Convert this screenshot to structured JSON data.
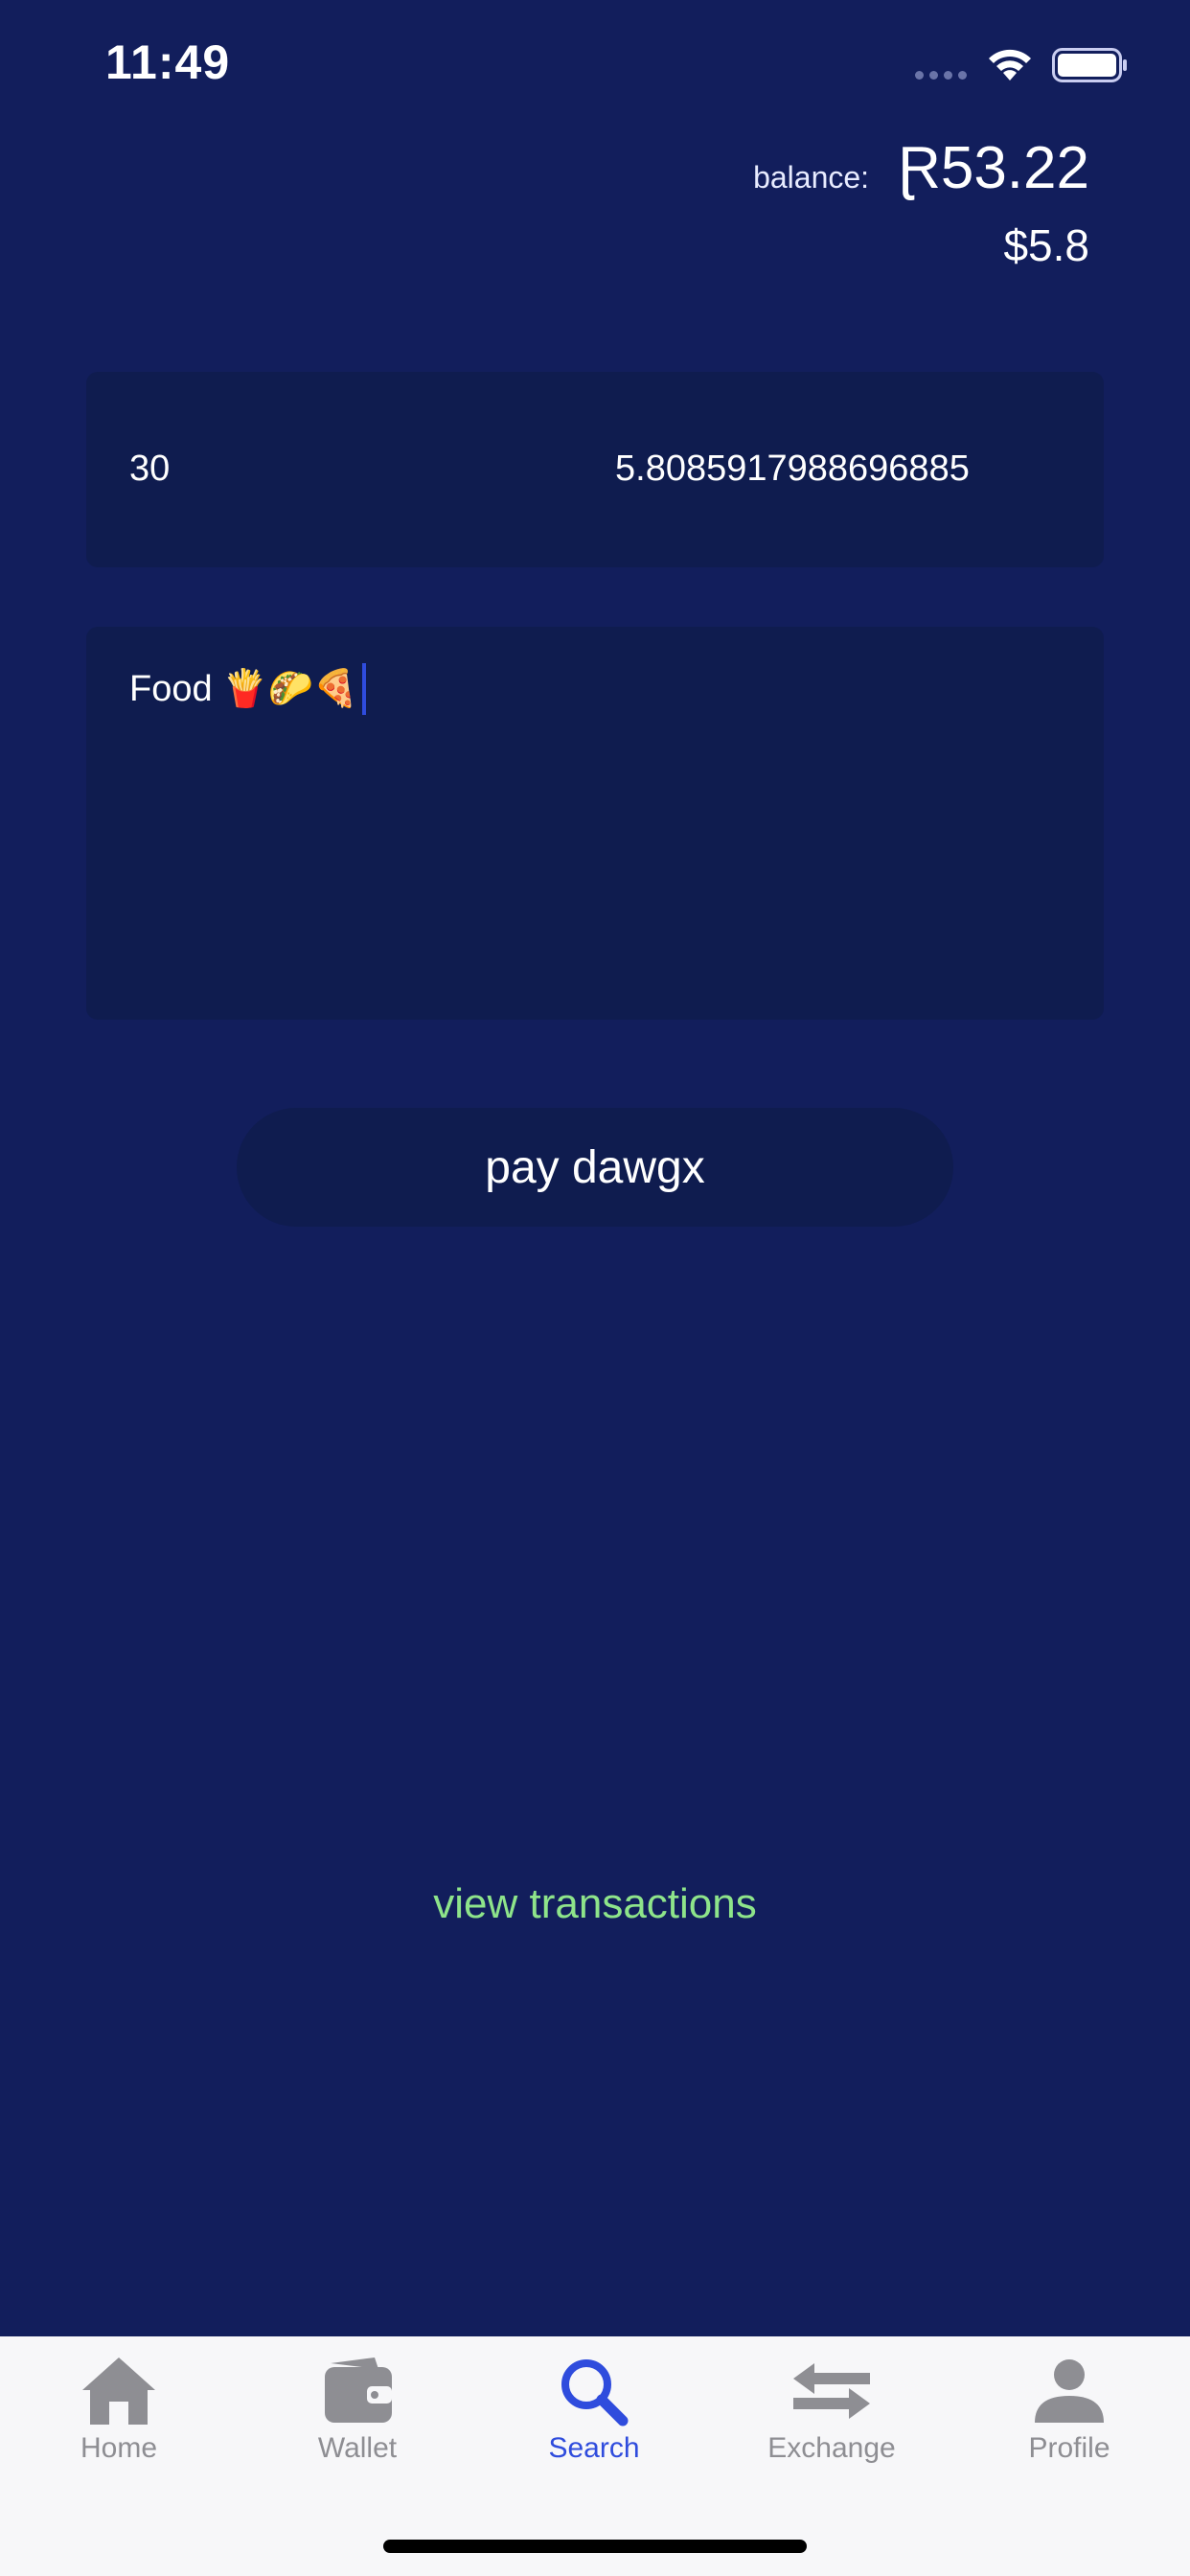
{
  "status_bar": {
    "time": "11:49"
  },
  "balance": {
    "label": "balance:",
    "primary": "Ɽ53.22",
    "secondary": "$5.8"
  },
  "payment_form": {
    "amount_value": "30",
    "converted_value": "5.8085917988696885",
    "memo_value": "Food 🍟🌮🍕",
    "pay_button_label": "pay dawgx"
  },
  "links": {
    "view_transactions": "view transactions"
  },
  "tab_bar": {
    "tabs": [
      {
        "label": "Home",
        "icon": "house-icon"
      },
      {
        "label": "Wallet",
        "icon": "wallet-icon"
      },
      {
        "label": "Search",
        "icon": "search-icon",
        "active": true
      },
      {
        "label": "Exchange",
        "icon": "exchange-arrows-icon"
      },
      {
        "label": "Profile",
        "icon": "person-icon"
      }
    ]
  },
  "colors": {
    "background": "#121e5c",
    "card": "#0f1c4f",
    "accent": "#2f4cdd",
    "link": "#8ee48a",
    "tab_inactive": "#8e8e93"
  }
}
